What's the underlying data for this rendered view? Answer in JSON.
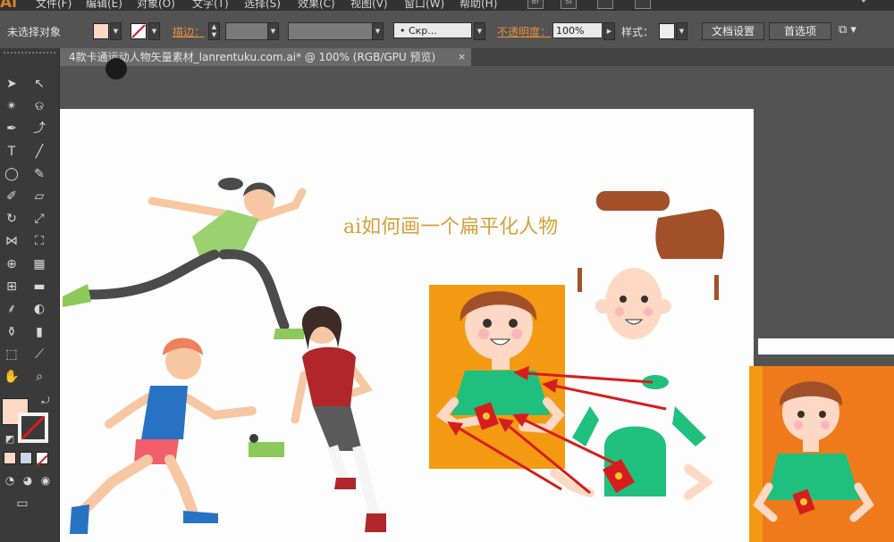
{
  "app": {
    "logo": "Ai"
  },
  "menu": [
    "文件(F)",
    "编辑(E)",
    "对象(O)",
    "文字(T)",
    "选择(S)",
    "效果(C)",
    "视图(V)",
    "窗口(W)",
    "帮助(H)"
  ],
  "menu_icons": [
    "Br",
    "St"
  ],
  "control_bar": {
    "selection_status": "未选择对象",
    "stroke_label": "描边：",
    "brush_label": "• Скр...",
    "opacity_label": "不透明度：",
    "opacity_value": "100%",
    "style_label": "样式：",
    "doc_setup_button": "文档设置",
    "preferences_button": "首选项"
  },
  "document_tab": {
    "title": "4款卡通运动人物矢量素材_lanrentuku.com.ai* @ 100% (RGB/GPU 预览)",
    "close": "×"
  },
  "artwork": {
    "title": "ai如何画一个扁平化人物"
  },
  "colors": {
    "fill": "#fdd8c4",
    "accent_orange": "#f39a12",
    "arrow_red": "#d61d1d",
    "shirt_green": "#1fc07e",
    "hair_brown": "#a2502a"
  }
}
